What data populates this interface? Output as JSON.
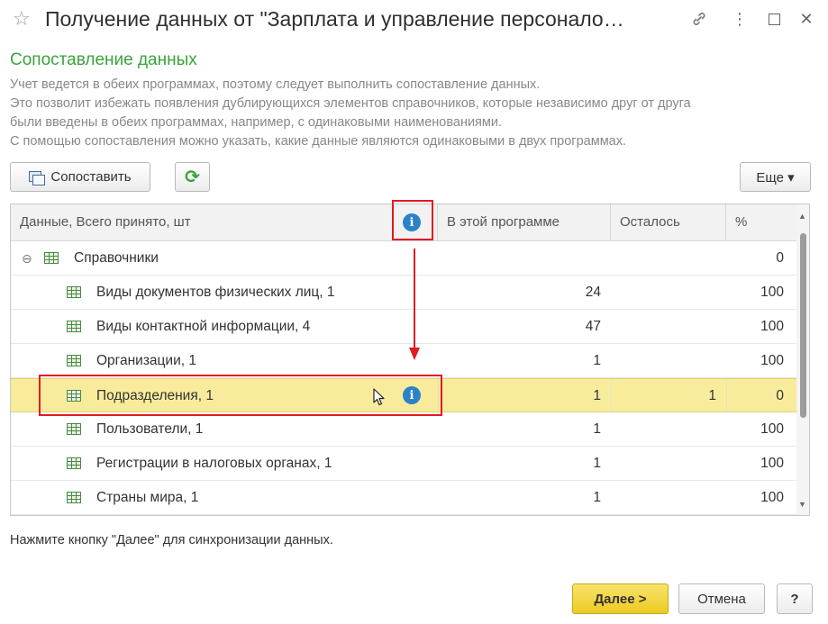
{
  "window": {
    "title": "Получение данных от \"Зарплата и управление персонало…",
    "star_icon": "☆",
    "link_icon": "🔗",
    "more_icon": "⋮",
    "maximize_icon": "☐",
    "close_icon": "✕"
  },
  "section": {
    "title": "Сопоставление данных",
    "lines": [
      "Учет ведется в обеих программах, поэтому следует выполнить сопоставление данных.",
      "Это позволит избежать появления дублирующихся элементов справочников, которые независимо друг от друга",
      "были введены в обеих программах, например, с одинаковыми наименованиями.",
      "С помощью сопоставления можно указать, какие данные являются одинаковыми в двух программах."
    ]
  },
  "toolbar": {
    "match_label": "Сопоставить",
    "refresh_icon": "⟳",
    "more_label": "Еще ▾"
  },
  "table": {
    "headers": {
      "data": "Данные, Всего принято, шт",
      "in_program": "В этой программе",
      "remaining": "Осталось",
      "percent": "%"
    },
    "group": {
      "toggle": "⊖",
      "name": "Справочники",
      "percent": "0"
    },
    "rows": [
      {
        "name": "Виды документов физических лиц, 1",
        "in_program": "24",
        "remaining": "",
        "percent": "100"
      },
      {
        "name": "Виды контактной информации, 4",
        "in_program": "47",
        "remaining": "",
        "percent": "100"
      },
      {
        "name": "Организации, 1",
        "in_program": "1",
        "remaining": "",
        "percent": "100"
      },
      {
        "name": "Подразделения, 1",
        "in_program": "1",
        "remaining": "1",
        "percent": "0"
      },
      {
        "name": "Пользователи, 1",
        "in_program": "1",
        "remaining": "",
        "percent": "100"
      },
      {
        "name": "Регистрации в налоговых органах, 1",
        "in_program": "1",
        "remaining": "",
        "percent": "100"
      },
      {
        "name": "Страны мира, 1",
        "in_program": "1",
        "remaining": "",
        "percent": "100"
      }
    ],
    "selected_row": 3
  },
  "hint": "Нажмите кнопку \"Далее\" для синхронизации данных.",
  "footer": {
    "next_label": "Далее >",
    "cancel_label": "Отмена",
    "help_label": "?"
  },
  "colors": {
    "section_title": "#3aa33a",
    "selected_row": "#f8ec9c",
    "accent_button": "#f3d43a",
    "info_icon": "#2c82c9",
    "annotation": "#e01b22"
  }
}
